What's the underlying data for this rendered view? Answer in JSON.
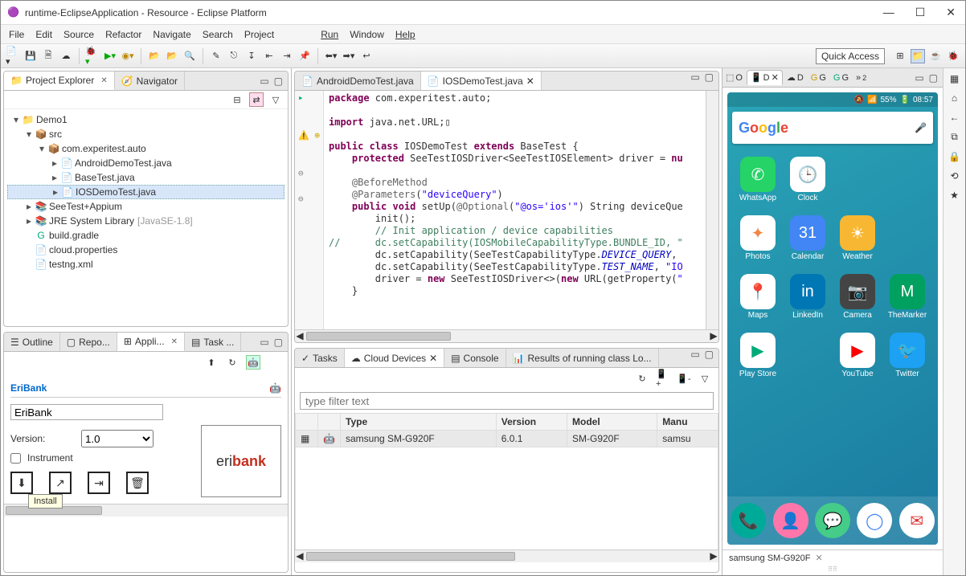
{
  "window": {
    "title": "runtime-EclipseApplication - Resource - Eclipse Platform"
  },
  "menu": [
    "File",
    "Edit",
    "Source",
    "Refactor",
    "Navigate",
    "Search",
    "Project",
    "Run",
    "Window",
    "Help"
  ],
  "quick_access": "Quick Access",
  "left": {
    "tabs": {
      "explorer": "Project Explorer",
      "navigator": "Navigator"
    },
    "tree": {
      "root": "Demo1",
      "src": "src",
      "pkg": "com.experitest.auto",
      "files": [
        "AndroidDemoTest.java",
        "BaseTest.java",
        "IOSDemoTest.java"
      ],
      "lib1": "SeeTest+Appium",
      "lib2": "JRE System Library",
      "lib2suffix": "[JavaSE-1.8]",
      "gradle": "build.gradle",
      "props": "cloud.properties",
      "testng": "testng.xml"
    },
    "bottom_tabs": {
      "outline": "Outline",
      "repo": "Repo...",
      "appli": "Appli...",
      "task": "Task ..."
    },
    "app": {
      "header": "EriBank",
      "name": "EriBank",
      "version_label": "Version:",
      "version_value": "1.0",
      "instrument": "Instrument",
      "tooltip": "Install"
    }
  },
  "center": {
    "editor_tabs": {
      "android": "AndroidDemoTest.java",
      "ios": "IOSDemoTest.java"
    },
    "code": "package com.experitest.auto;\n\nimport java.net.URL;▯\n\npublic class IOSDemoTest extends BaseTest {\n    protected SeeTestIOSDriver<SeeTestIOSElement> driver = nu\n\n    @BeforeMethod\n    @Parameters(\"deviceQuery\")\n    public void setUp(@Optional(\"@os='ios'\") String deviceQue\n        init();\n        // Init application / device capabilities\n//      dc.setCapability(IOSMobileCapabilityType.BUNDLE_ID, \"\n        dc.setCapability(SeeTestCapabilityType.DEVICE_QUERY, \n        dc.setCapability(SeeTestCapabilityType.TEST_NAME, \"IO\n        driver = new SeeTestIOSDriver<>(new URL(getProperty(\"\n    }\n",
    "bottom": {
      "tabs": {
        "tasks": "Tasks",
        "cloud": "Cloud Devices",
        "console": "Console",
        "results": "Results of running class Lo..."
      },
      "filter_placeholder": "type filter text",
      "columns": [
        "",
        "",
        "Type",
        "Version",
        "Model",
        "Manu"
      ],
      "row": {
        "type": "samsung SM-G920F",
        "version": "6.0.1",
        "model": "SM-G920F",
        "manu": "samsu"
      }
    }
  },
  "right": {
    "tabs": {
      "o": "O",
      "d": "D",
      "d2": "D",
      "g": "G",
      "g2": "G"
    },
    "status": {
      "signal": "📶",
      "battery": "55%",
      "time": "08:57"
    },
    "search_brand": "Google",
    "apps": [
      {
        "label": "WhatsApp",
        "bg": "#25D366",
        "glyph": "✆"
      },
      {
        "label": "Clock",
        "bg": "#ffffff",
        "glyph": "🕒",
        "fg": "#333"
      },
      {
        "label": "",
        "bg": "transparent",
        "glyph": ""
      },
      {
        "label": "",
        "bg": "transparent",
        "glyph": ""
      },
      {
        "label": "Photos",
        "bg": "#ffffff",
        "glyph": "✦",
        "fg": "#E84"
      },
      {
        "label": "Calendar",
        "bg": "#4285F4",
        "glyph": "31"
      },
      {
        "label": "Weather",
        "bg": "#f7b733",
        "glyph": "☀"
      },
      {
        "label": "",
        "bg": "transparent",
        "glyph": ""
      },
      {
        "label": "Maps",
        "bg": "#ffffff",
        "glyph": "📍",
        "fg": "#0a7"
      },
      {
        "label": "LinkedIn",
        "bg": "#0077B5",
        "glyph": "in"
      },
      {
        "label": "Camera",
        "bg": "#444",
        "glyph": "📷"
      },
      {
        "label": "TheMarker",
        "bg": "#00a060",
        "glyph": "M"
      },
      {
        "label": "Play Store",
        "bg": "#ffffff",
        "glyph": "▶",
        "fg": "#0a7"
      },
      {
        "label": "",
        "bg": "transparent",
        "glyph": ""
      },
      {
        "label": "YouTube",
        "bg": "#ffffff",
        "glyph": "▶",
        "fg": "#f00"
      },
      {
        "label": "Twitter",
        "bg": "#1DA1F2",
        "glyph": "🐦"
      }
    ],
    "dock": [
      {
        "bg": "#0a9",
        "glyph": "📞"
      },
      {
        "bg": "#f7a",
        "glyph": "👤"
      },
      {
        "bg": "#4c8",
        "glyph": "💬"
      },
      {
        "bg": "#fff",
        "glyph": "◯",
        "fg": "#4285F4"
      },
      {
        "bg": "#fff",
        "glyph": "✉",
        "fg": "#d33"
      }
    ],
    "device_label": "samsung SM-G920F"
  }
}
